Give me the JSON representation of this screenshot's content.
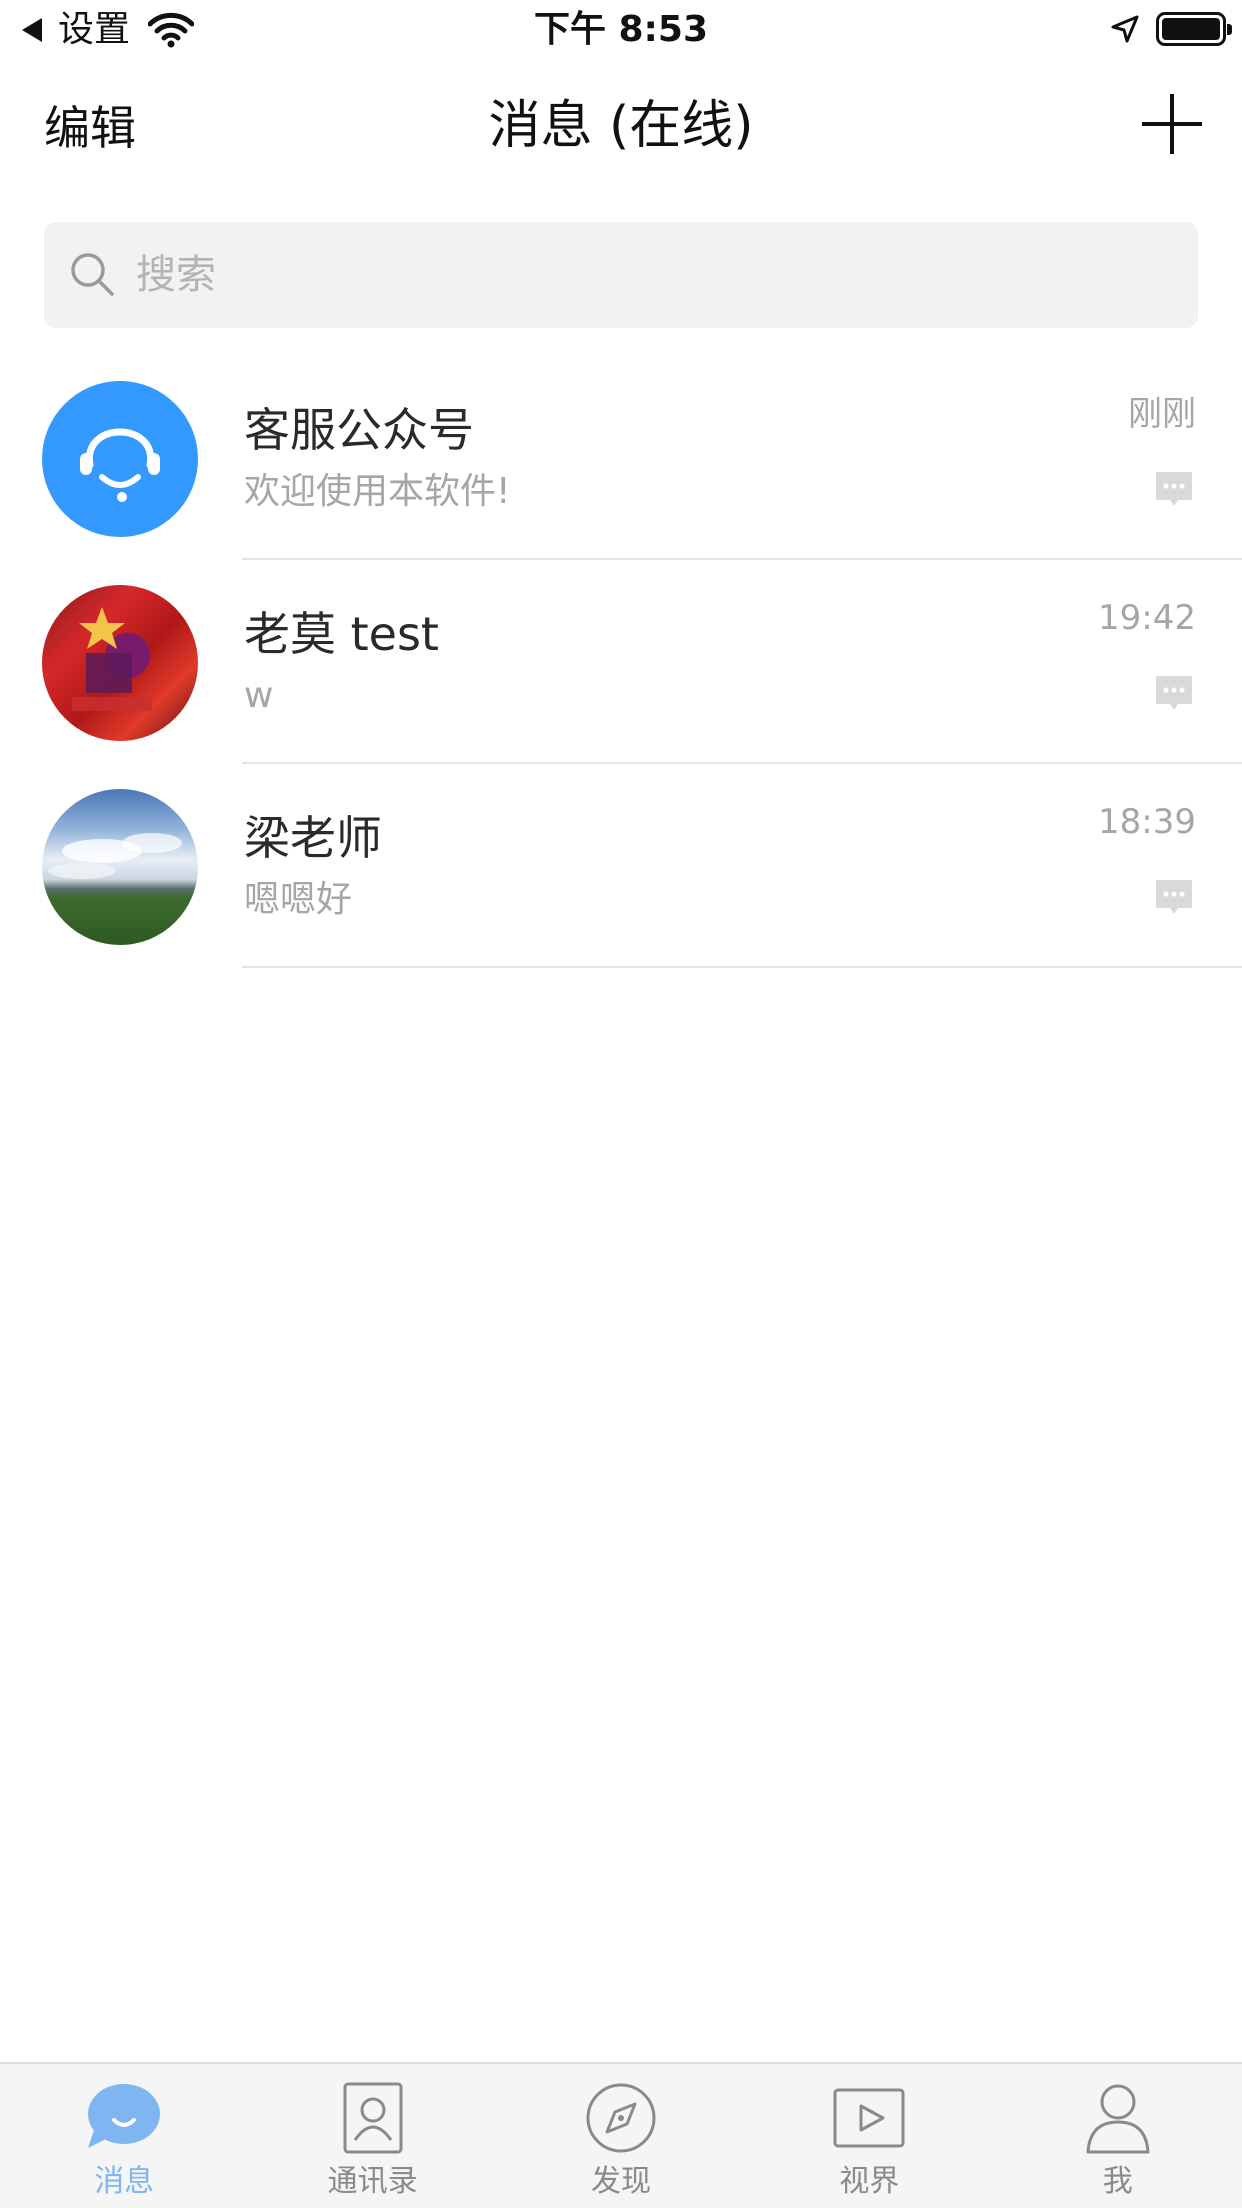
{
  "status_bar": {
    "back_label": "设置",
    "time": "下午 8:53"
  },
  "nav": {
    "edit_label": "编辑",
    "title": "消息 (在线)"
  },
  "search": {
    "placeholder": "搜索"
  },
  "messages": [
    {
      "name": "客服公众号",
      "preview": "欢迎使用本软件!",
      "time": "刚刚",
      "avatar": "customer-service-icon"
    },
    {
      "name": "老莫 test",
      "preview": "w",
      "time": "19:42",
      "avatar": "photo-avatar-red"
    },
    {
      "name": "梁老师",
      "preview": "嗯嗯好",
      "time": "18:39",
      "avatar": "photo-avatar-sky"
    }
  ],
  "tabs": [
    {
      "label": "消息",
      "icon": "chat-bubble-icon",
      "active": true
    },
    {
      "label": "通讯录",
      "icon": "contact-card-icon",
      "active": false
    },
    {
      "label": "发现",
      "icon": "compass-icon",
      "active": false
    },
    {
      "label": "视界",
      "icon": "play-icon",
      "active": false
    },
    {
      "label": "我",
      "icon": "person-icon",
      "active": false
    }
  ],
  "colors": {
    "accent": "#3399ff",
    "tab_active": "#7fb6f1",
    "secondary_text": "#a6a6a6"
  }
}
